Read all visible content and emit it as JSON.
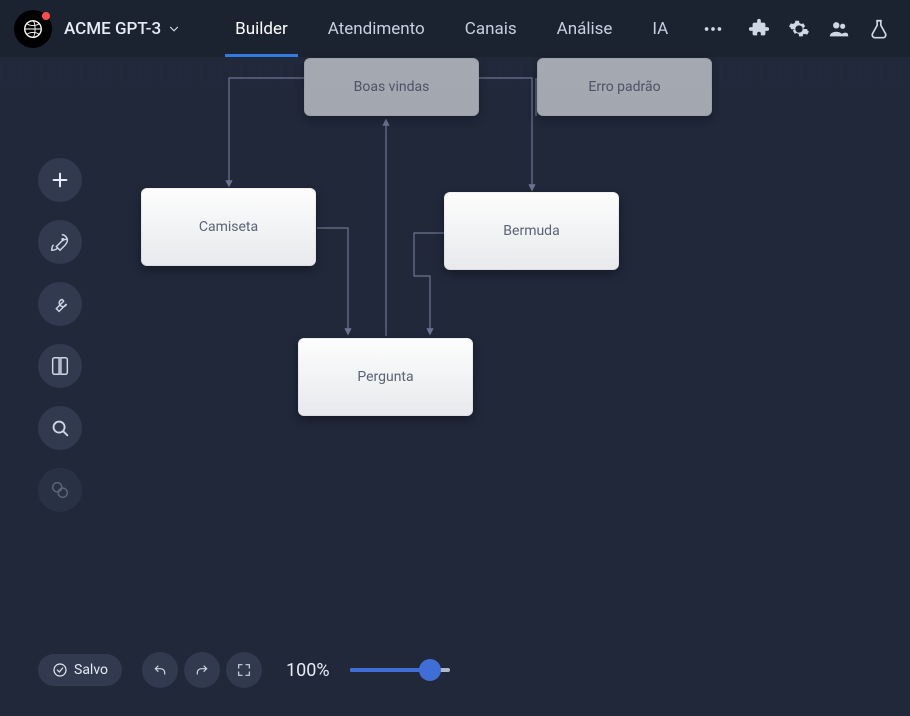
{
  "header": {
    "project_name": "ACME GPT-3",
    "tabs": [
      {
        "label": "Builder",
        "active": true
      },
      {
        "label": "Atendimento",
        "active": false
      },
      {
        "label": "Canais",
        "active": false
      },
      {
        "label": "Análise",
        "active": false
      },
      {
        "label": "IA",
        "active": false
      }
    ]
  },
  "nodes": {
    "boas_vindas": "Boas vindas",
    "erro_padrao": "Erro padrão",
    "camiseta": "Camiseta",
    "bermuda": "Bermuda",
    "pergunta": "Pergunta"
  },
  "bottom": {
    "status": "Salvo",
    "zoom_label": "100%",
    "zoom_percent": 100
  }
}
